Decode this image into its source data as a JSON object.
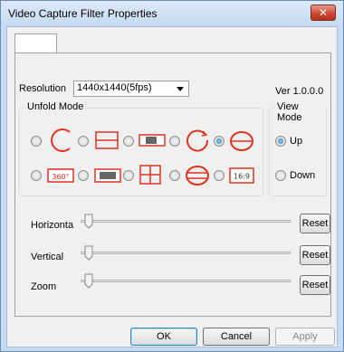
{
  "window": {
    "title": "Video Capture Filter Properties",
    "close_glyph": "✕"
  },
  "tabs": [
    {
      "label": ""
    }
  ],
  "resolution": {
    "label": "Resolution",
    "value": "1440x1440(5fps)"
  },
  "version": "Ver 1.0.0.0",
  "unfold_mode": {
    "title": "Unfold Mode",
    "selected_index": 4,
    "row1_icons": [
      "circle-arc-icon",
      "rect-two-bands-icon",
      "panorama-strip-icon",
      "circle-open-icon",
      "ellipse-split-icon"
    ],
    "row2_icons": [
      "360-panorama-icon",
      "single-view-icon",
      "quad-view-icon",
      "ellipse-band-icon",
      "16-9-view-icon"
    ],
    "label_360": "360°",
    "label_169": "16:9"
  },
  "view_mode": {
    "title": "View Mode",
    "options": [
      {
        "label": "Up",
        "checked": true
      },
      {
        "label": "Down",
        "checked": false
      }
    ]
  },
  "sliders": [
    {
      "label": "Horizonta",
      "value": 0,
      "reset_label": "Reset"
    },
    {
      "label": "Vertical",
      "value": 0,
      "reset_label": "Reset"
    },
    {
      "label": "Zoom",
      "value": 0,
      "reset_label": "Reset"
    }
  ],
  "footer": {
    "ok_label": "OK",
    "cancel_label": "Cancel",
    "apply_label": "Apply"
  },
  "colors": {
    "accent_red": "#e0321f",
    "radio_checked": "#1f6ab6"
  }
}
